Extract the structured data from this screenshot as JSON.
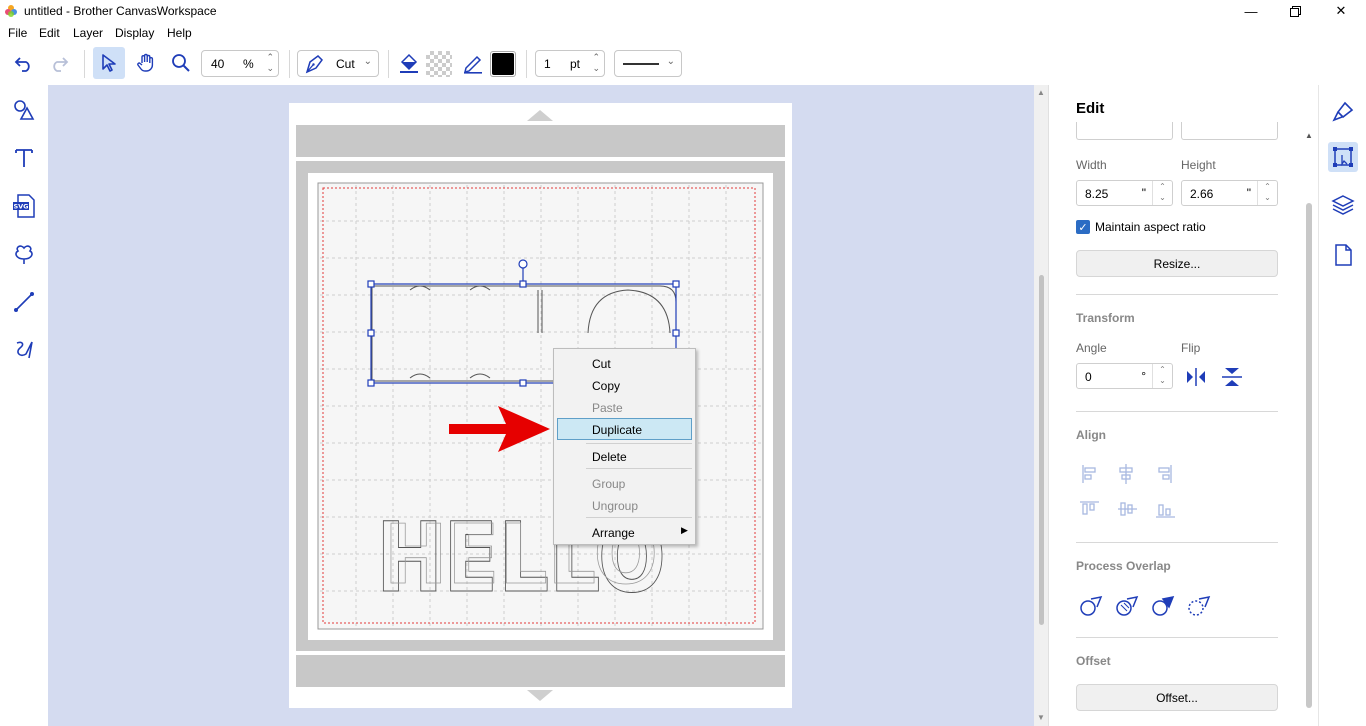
{
  "window": {
    "title": "untitled - Brother CanvasWorkspace"
  },
  "menubar": {
    "items": [
      "File",
      "Edit",
      "Layer",
      "Display",
      "Help"
    ]
  },
  "toolbar": {
    "zoom_value": "40",
    "zoom_unit": "%",
    "mode_label": "Cut",
    "line_width_value": "1",
    "line_width_unit": "pt"
  },
  "context_menu": {
    "cut": "Cut",
    "copy": "Copy",
    "paste": "Paste",
    "duplicate": "Duplicate",
    "delete": "Delete",
    "group": "Group",
    "ungroup": "Ungroup",
    "arrange": "Arrange"
  },
  "edit_panel": {
    "title": "Edit",
    "width_label": "Width",
    "height_label": "Height",
    "width_value": "8.25",
    "height_value": "2.66",
    "unit": "\"",
    "maintain_aspect_label": "Maintain aspect ratio",
    "maintain_aspect_checked": true,
    "resize_button": "Resize...",
    "transform_head": "Transform",
    "angle_label": "Angle",
    "flip_label": "Flip",
    "angle_value": "0",
    "angle_unit": "°",
    "align_head": "Align",
    "process_overlap_head": "Process Overlap",
    "offset_head": "Offset",
    "offset_button": "Offset..."
  },
  "canvas": {
    "text_object": "HELLO"
  },
  "colors": {
    "canvas_bg": "#d4dbf0",
    "accent_blue": "#1f3db8",
    "highlight": "#cce8f4",
    "arrow_red": "#e60000"
  }
}
